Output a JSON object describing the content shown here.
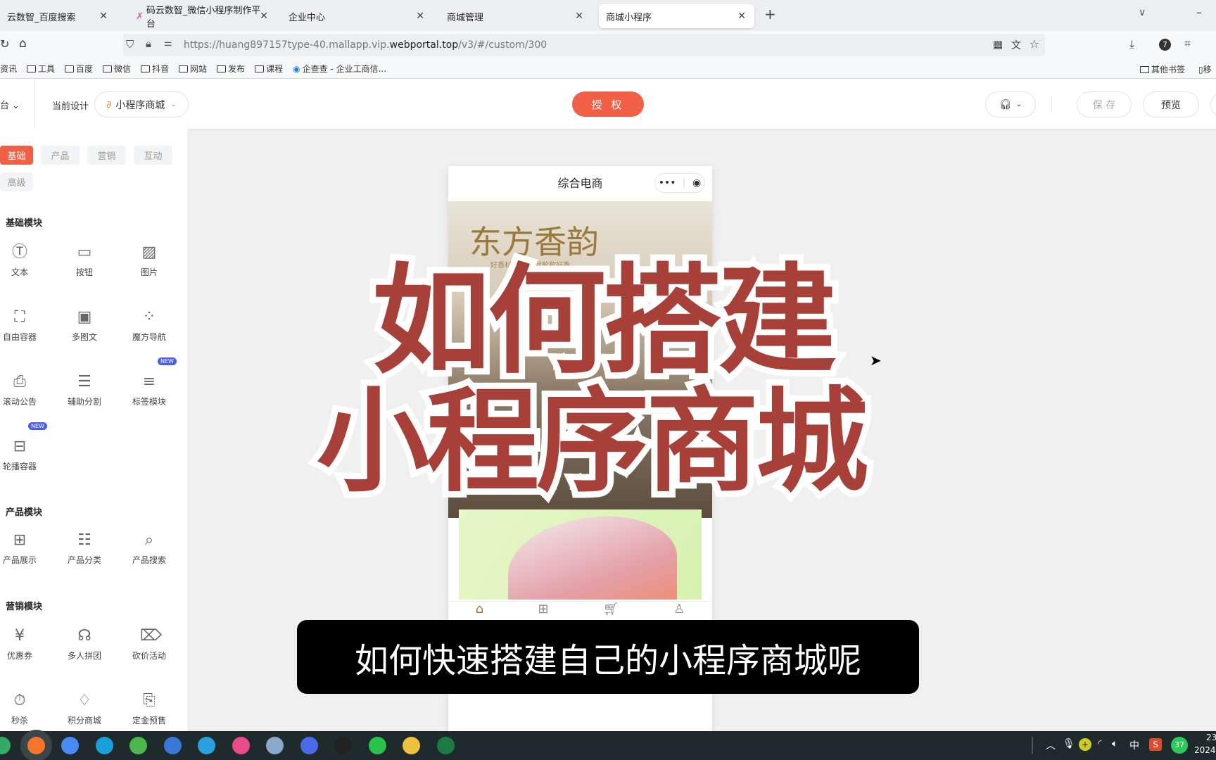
{
  "browser": {
    "tabs": [
      {
        "label": "云数智_百度搜索"
      },
      {
        "label": "码云数智_微信小程序制作平台"
      },
      {
        "label": "企业中心"
      },
      {
        "label": "商城管理"
      },
      {
        "label": "商城小程序",
        "active": true
      }
    ],
    "url_prefix": "https://huang897157type-40.mallapp.vip.",
    "url_domain": "webportal.top",
    "url_suffix": "/v3/#/custom/300",
    "bookmarks": [
      "资讯",
      "工具",
      "百度",
      "微信",
      "抖音",
      "网站",
      "发布",
      "课程"
    ],
    "bookmark_link": "企查查 - 企业工商信...",
    "bookmarks_right": [
      "其他书签",
      "移"
    ],
    "badge_count": "7"
  },
  "header": {
    "left_menu": "台",
    "current_design_label": "当前设计",
    "design_select": "小程序商城",
    "auth_button": "授 权",
    "save_button": "保 存",
    "preview_button": "预览"
  },
  "sidebar": {
    "tabs": [
      "基础",
      "产品",
      "营销",
      "互动",
      "高级"
    ],
    "active_tab": "基础",
    "sections": [
      {
        "title": "基础模块",
        "items": [
          {
            "label": "文本",
            "icon": "text-icon"
          },
          {
            "label": "按钮",
            "icon": "button-icon"
          },
          {
            "label": "图片",
            "icon": "image-icon"
          },
          {
            "label": "自由容器",
            "icon": "container-icon"
          },
          {
            "label": "多图文",
            "icon": "gallery-icon"
          },
          {
            "label": "魔方导航",
            "icon": "grid-dots-icon"
          },
          {
            "label": "滚动公告",
            "icon": "notice-icon"
          },
          {
            "label": "辅助分割",
            "icon": "divider-icon"
          },
          {
            "label": "标签模块",
            "icon": "tag-list-icon",
            "badge": "NEW"
          },
          {
            "label": "轮播容器",
            "icon": "carousel-icon",
            "badge": "NEW"
          }
        ]
      },
      {
        "title": "产品模块",
        "items": [
          {
            "label": "产品展示",
            "icon": "product-grid-icon"
          },
          {
            "label": "产品分类",
            "icon": "category-icon"
          },
          {
            "label": "产品搜索",
            "icon": "product-search-icon"
          }
        ]
      },
      {
        "title": "营销模块",
        "items": [
          {
            "label": "优惠券",
            "icon": "coupon-icon"
          },
          {
            "label": "多人拼团",
            "icon": "group-buy-icon"
          },
          {
            "label": "砍价活动",
            "icon": "bargain-icon"
          },
          {
            "label": "秒杀",
            "icon": "flash-sale-icon"
          },
          {
            "label": "积分商城",
            "icon": "points-mall-icon"
          },
          {
            "label": "定金预售",
            "icon": "presale-icon"
          }
        ]
      }
    ]
  },
  "phone": {
    "title": "综合电商",
    "banner_title": "东方香韵",
    "banner_subtitle": "好香材料 款款就款款好香"
  },
  "overlay": {
    "line1": "如何搭建",
    "line2": "小程序商城"
  },
  "caption": "如何快速搭建自己的小程序商城呢",
  "tray": {
    "ime": "中",
    "badge": "37",
    "time": "23",
    "date": "2024"
  },
  "colors": {
    "accent": "#ef6046",
    "overlay_red": "#a8403a",
    "taskbar": "#1f2a2c",
    "new_badge": "#4a5ee6"
  }
}
